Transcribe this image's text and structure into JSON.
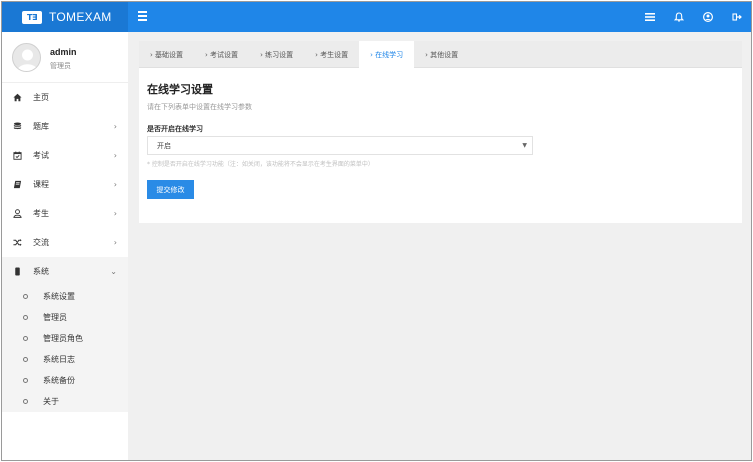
{
  "header": {
    "logo_text": "T∃",
    "brand": "TOMEXAM",
    "icons": [
      "menu-icon",
      "list-icon",
      "bell-icon",
      "user-circle-icon",
      "logout-icon"
    ]
  },
  "user": {
    "name": "admin",
    "role": "管理员"
  },
  "sidebar": {
    "items": [
      {
        "label": "主页",
        "icon": "home-icon",
        "chevron": ""
      },
      {
        "label": "题库",
        "icon": "database-icon",
        "chevron": "›"
      },
      {
        "label": "考试",
        "icon": "calendar-check-icon",
        "chevron": "›"
      },
      {
        "label": "课程",
        "icon": "book-icon",
        "chevron": "›"
      },
      {
        "label": "考生",
        "icon": "user-icon",
        "chevron": "›"
      },
      {
        "label": "交流",
        "icon": "shuffle-icon",
        "chevron": "›"
      },
      {
        "label": "系统",
        "icon": "device-icon",
        "chevron": "⌄"
      }
    ],
    "sub_items": [
      "系统设置",
      "管理员",
      "管理员角色",
      "系统日志",
      "系统备份",
      "关于"
    ]
  },
  "tabs": [
    {
      "label": "› 基础设置",
      "active": false
    },
    {
      "label": "› 考试设置",
      "active": false
    },
    {
      "label": "› 练习设置",
      "active": false
    },
    {
      "label": "› 考生设置",
      "active": false
    },
    {
      "label": "› 在线学习",
      "active": true
    },
    {
      "label": "› 其他设置",
      "active": false
    }
  ],
  "panel": {
    "title": "在线学习设置",
    "description": "请在下列表单中设置在线学习参数",
    "field_label": "是否开启在线学习",
    "select_value": "开启",
    "select_caret": "▼",
    "hint": "* 控制是否开启在线学习功能（注：如关闭，该功能将不会显示在考生界面的菜单中）",
    "submit_label": "提交修改"
  },
  "colors": {
    "topbar": "#1f86e8",
    "brand_bg": "#1a78d4",
    "accent": "#2a8be6",
    "background": "#f0f0f0"
  }
}
